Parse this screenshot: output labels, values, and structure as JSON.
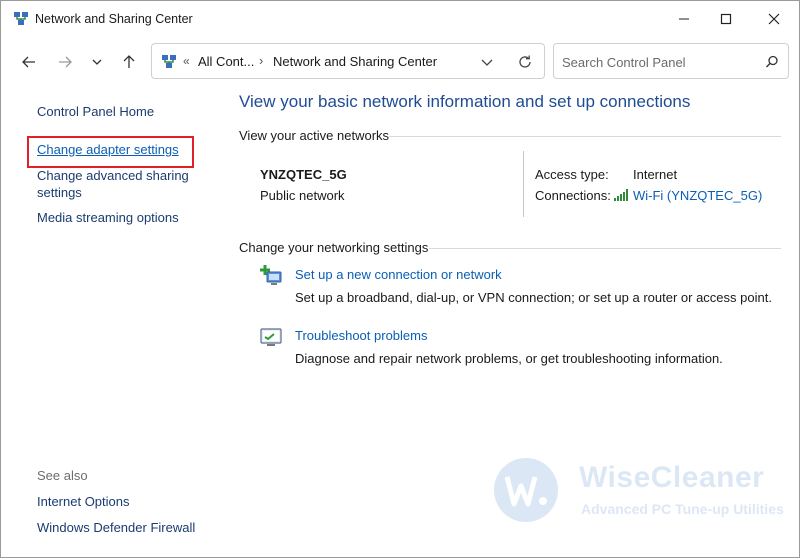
{
  "window": {
    "title": "Network and Sharing Center"
  },
  "address_bar": {
    "crumbs": [
      "«",
      "All Cont...",
      "›",
      "Network and Sharing Center"
    ]
  },
  "search": {
    "placeholder": "Search Control Panel"
  },
  "left_pane": {
    "home": "Control Panel Home",
    "links": [
      "Change adapter settings",
      "Change advanced sharing settings",
      "Media streaming options"
    ],
    "see_also_title": "See also",
    "see_also": [
      "Internet Options",
      "Windows Defender Firewall"
    ]
  },
  "main": {
    "heading": "View your basic network information and set up connections",
    "active_networks_title": "View your active networks",
    "network": {
      "name": "YNZQTEC_5G",
      "type": "Public network",
      "access_type_label": "Access type:",
      "access_type_value": "Internet",
      "connections_label": "Connections:",
      "connections_value": "Wi-Fi (YNZQTEC_5G)"
    },
    "change_settings_title": "Change your networking settings",
    "tasks": [
      {
        "link": "Set up a new connection or network",
        "description": "Set up a broadband, dial-up, or VPN connection; or set up a router or access point.",
        "icon": "new-connection-icon"
      },
      {
        "link": "Troubleshoot problems",
        "description": "Diagnose and repair network problems, or get troubleshooting information.",
        "icon": "troubleshoot-icon"
      }
    ]
  },
  "watermark": {
    "brand": "WiseCleaner",
    "tagline": "Advanced PC Tune-up Utilities"
  },
  "colors": {
    "link": "#0a5fb4",
    "heading": "#1e4c94",
    "highlight": "#e0202a"
  }
}
